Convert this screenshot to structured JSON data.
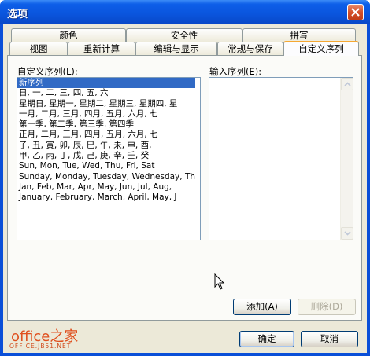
{
  "window": {
    "title": "选项"
  },
  "tabs": {
    "row1": [
      "颜色",
      "安全性",
      "拼写"
    ],
    "row2": [
      "视图",
      "重新计算",
      "编辑与显示",
      "常规与保存",
      "自定义序列"
    ],
    "active": "自定义序列"
  },
  "custom_lists": {
    "label": "自定义序列(L):",
    "items": [
      "新序列",
      "日, 一, 二, 三, 四, 五, 六",
      "星期日, 星期一, 星期二, 星期三, 星期四, 星",
      "一月, 二月, 三月, 四月, 五月, 六月, 七",
      "第一季, 第二季, 第三季, 第四季",
      "正月, 二月, 三月, 四月, 五月, 六月, 七",
      "子, 丑, 寅, 卯, 辰, 巳, 午, 未, 申, 酉,",
      "甲, 乙, 丙, 丁, 戊, 己, 庚, 辛, 壬, 癸",
      "Sun, Mon, Tue, Wed, Thu, Fri, Sat",
      "Sunday, Monday, Tuesday, Wednesday, Th",
      "Jan, Feb, Mar, Apr, May, Jun, Jul, Aug,",
      "January, February, March, April, May, J"
    ],
    "selected_index": 0
  },
  "input_list": {
    "label": "输入序列(E):",
    "value": ""
  },
  "buttons": {
    "add": "添加(A)",
    "delete": "删除(D)",
    "ok": "确定",
    "cancel": "取消"
  },
  "watermark": {
    "logo": "office之家",
    "sub": "OFFICE.JB51.NET"
  },
  "colors": {
    "title_bar": "#0a55dd",
    "selection": "#316ac5",
    "active_tab_accent": "#f5a833",
    "watermark": "#e0501e"
  }
}
